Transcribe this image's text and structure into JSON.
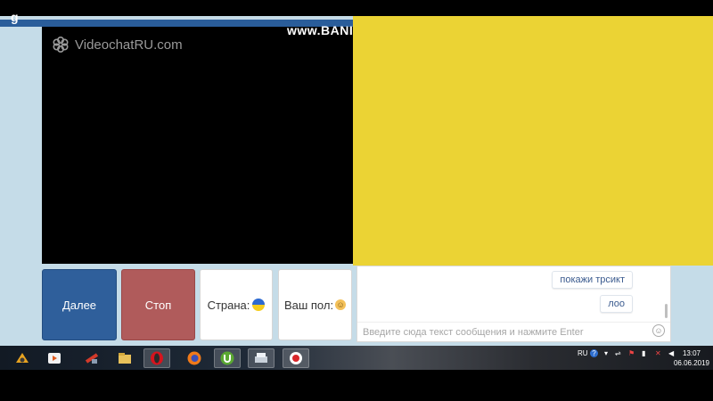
{
  "browser": {
    "banner_text": "www.BANI",
    "corner_glyph": "g"
  },
  "site": {
    "logo_text": "VideochatRU.com",
    "logo_icon": "flower-logo-icon"
  },
  "controls": {
    "next_label": "Далее",
    "stop_label": "Стоп",
    "country_label": "Страна:",
    "country_flag": "ukraine-flag-icon",
    "gender_label": "Ваш пол:",
    "gender_icon": "face-icon"
  },
  "chat": {
    "messages": [
      {
        "text": "покажи трсикт"
      },
      {
        "text": "лоо"
      }
    ],
    "input_placeholder": "Введите сюда текст сообщения и нажмите Enter"
  },
  "taskbar": {
    "apps": [
      "winamp-icon",
      "media-player-icon",
      "ccleaner-icon",
      "file-explorer-icon",
      "opera-icon",
      "firefox-icon",
      "utorrent-icon",
      "scanner-icon",
      "bandicam-icon"
    ],
    "language": "RU",
    "time": "13:07",
    "date": "06.06.2019"
  },
  "colors": {
    "remote_video": "#ebd334",
    "next_button": "#2f5f9b",
    "stop_button": "#b05b5b",
    "page_bg": "#c5dce8"
  }
}
